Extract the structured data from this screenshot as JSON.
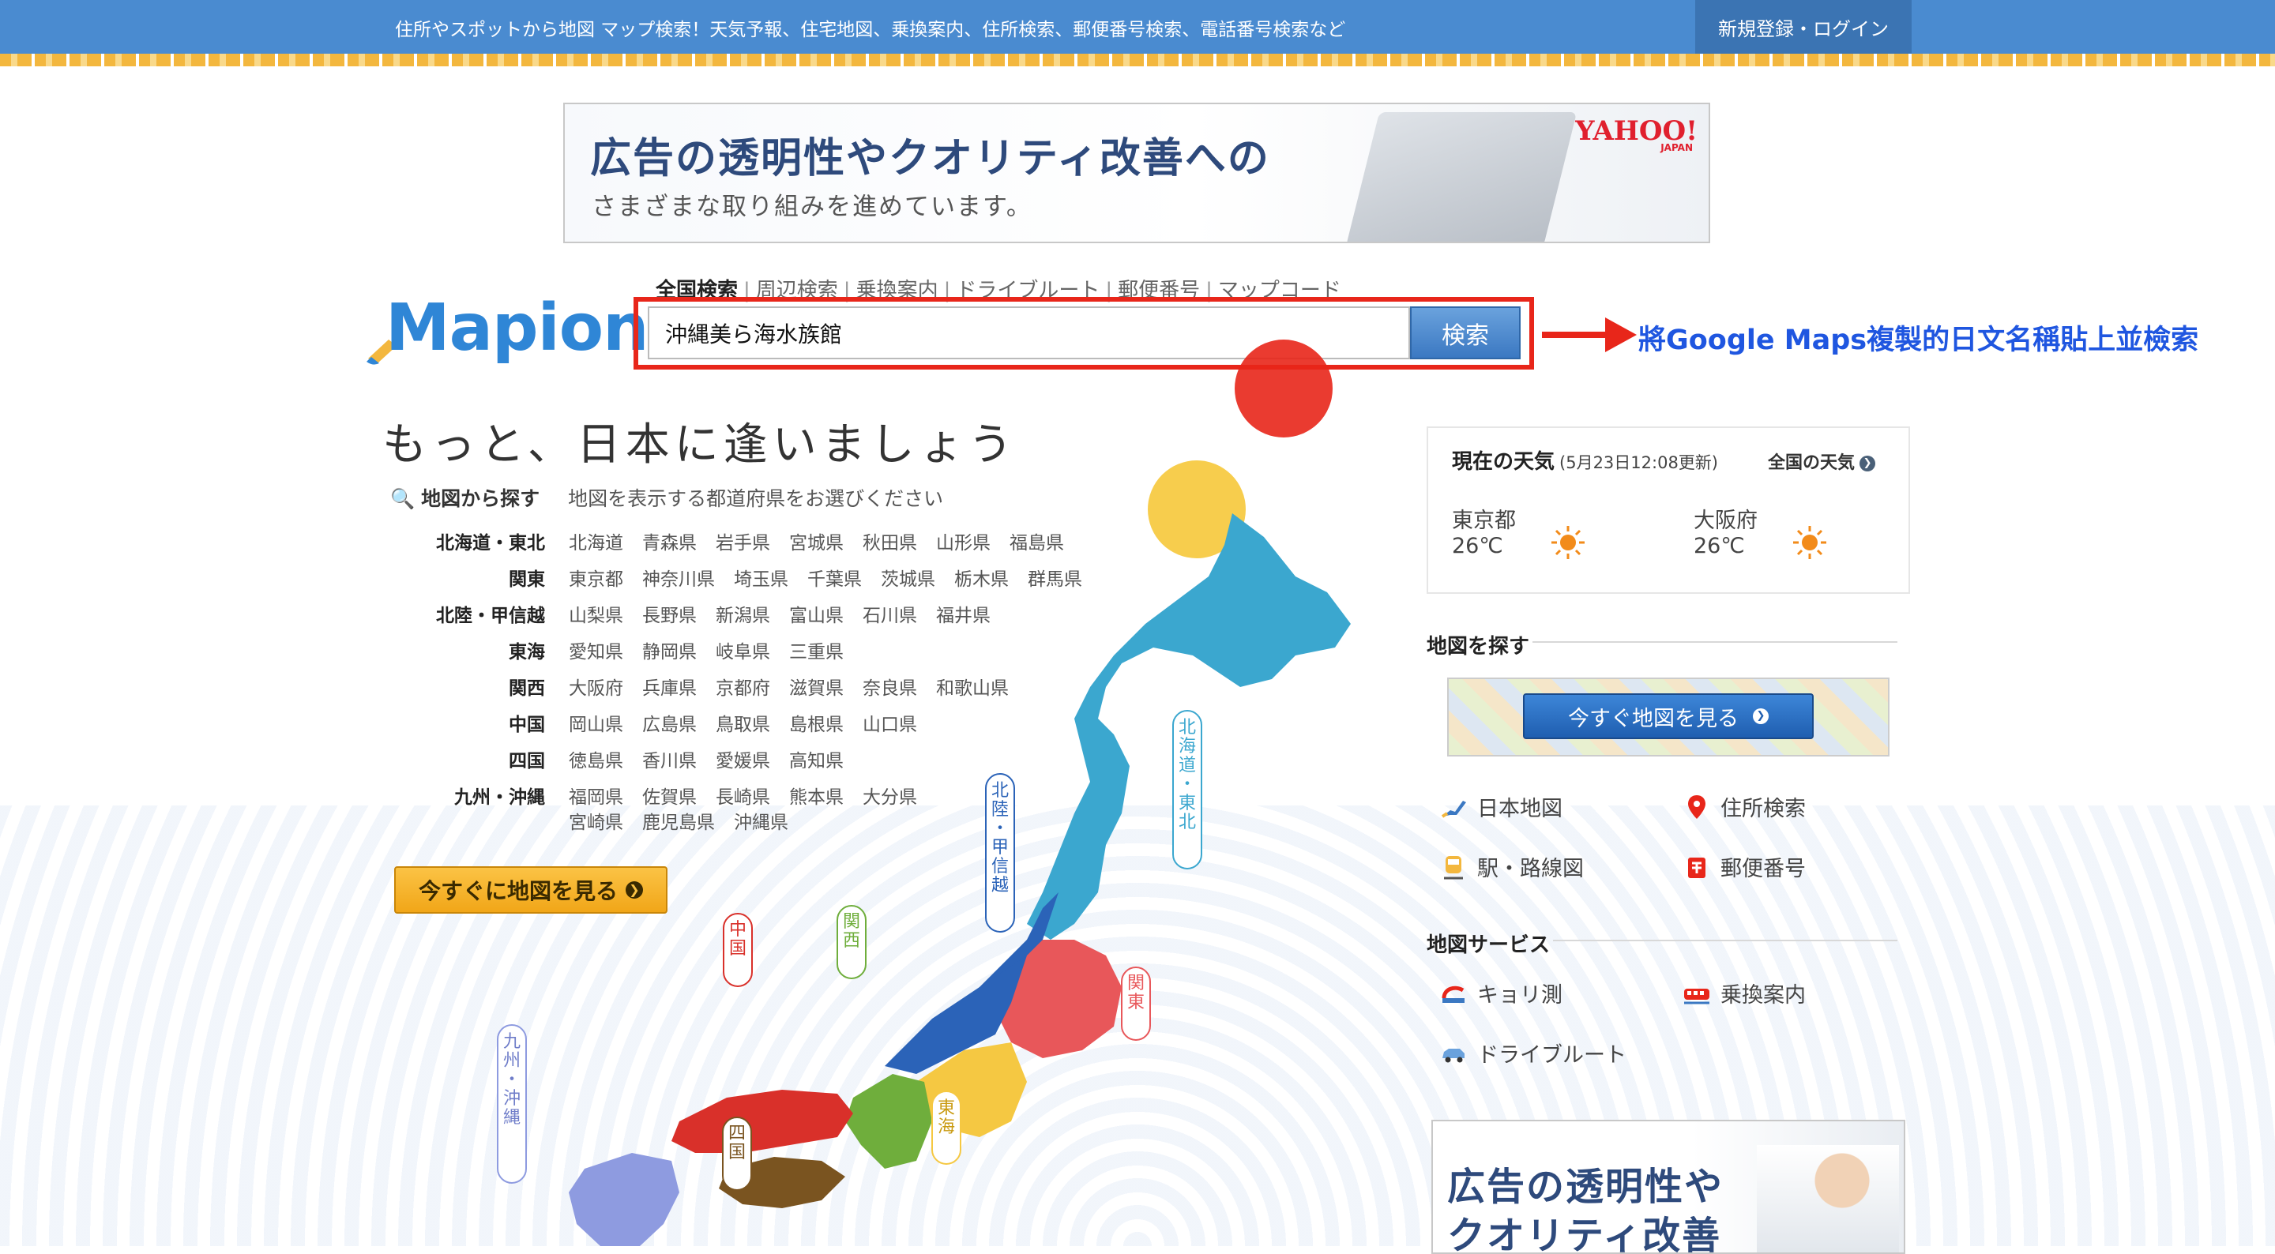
{
  "header": {
    "tagline": "住所やスポットから地図 マップ検索！天気予報、住宅地図、乗換案内、住所検索、郵便番号検索、電話番号検索など",
    "login_label": "新規登録・ログイン",
    "bar_color": "#4a8bd0"
  },
  "ad_top": {
    "title": "広告の透明性やクオリティ改善への",
    "subtitle": "さまざまな取り組みを進めています。",
    "logo": "YAHOO!",
    "logo_sub": "JAPAN"
  },
  "brand": {
    "logo": "Mapion",
    "color": "#2f86d6"
  },
  "search": {
    "tabs": [
      "全国検索",
      "周辺検索",
      "乗換案内",
      "ドライブルート",
      "郵便番号",
      "マップコード"
    ],
    "active_tab": "全国検索",
    "value": "沖縄美ら海水族館",
    "button_label": "検索",
    "highlight_color": "#e8261a"
  },
  "annotation": {
    "text": "將Google Maps複製的日文名稱貼上並檢索",
    "color": "#1f56e0"
  },
  "main": {
    "headline": "もっと、日本に逢いましょう",
    "find_label": "地図から探す",
    "find_hint": "地図を表示する都道府県をお選びください",
    "regions": [
      {
        "name": "北海道・東北",
        "prefs": [
          "北海道",
          "青森県",
          "岩手県",
          "宮城県",
          "秋田県",
          "山形県",
          "福島県"
        ]
      },
      {
        "name": "関東",
        "prefs": [
          "東京都",
          "神奈川県",
          "埼玉県",
          "千葉県",
          "茨城県",
          "栃木県",
          "群馬県"
        ]
      },
      {
        "name": "北陸・甲信越",
        "prefs": [
          "山梨県",
          "長野県",
          "新潟県",
          "富山県",
          "石川県",
          "福井県"
        ]
      },
      {
        "name": "東海",
        "prefs": [
          "愛知県",
          "静岡県",
          "岐阜県",
          "三重県"
        ]
      },
      {
        "name": "関西",
        "prefs": [
          "大阪府",
          "兵庫県",
          "京都府",
          "滋賀県",
          "奈良県",
          "和歌山県"
        ]
      },
      {
        "name": "中国",
        "prefs": [
          "岡山県",
          "広島県",
          "鳥取県",
          "島根県",
          "山口県"
        ]
      },
      {
        "name": "四国",
        "prefs": [
          "徳島県",
          "香川県",
          "愛媛県",
          "高知県"
        ]
      },
      {
        "name": "九州・沖縄",
        "prefs": [
          "福岡県",
          "佐賀県",
          "長崎県",
          "熊本県",
          "大分県"
        ],
        "prefs2": [
          "宮崎県",
          "鹿児島県",
          "沖縄県"
        ]
      }
    ],
    "cta_label": "今すぐに地図を見る",
    "map_labels": {
      "hokkaido": "北海道・東北",
      "hokuriku": "北陸・甲信越",
      "kanto": "関東",
      "chugoku": "中国",
      "kansai": "関西",
      "tokai": "東海",
      "shikoku": "四国",
      "kyushu": "九州・沖縄"
    },
    "region_colors": {
      "hokkaido": "#3ba7cf",
      "kanto": "#e8575a",
      "hokuriku": "#2b63b8",
      "tokai": "#f5c842",
      "kansai": "#6fae3c",
      "chugoku": "#d9302a",
      "shikoku": "#7a5420",
      "kyushu": "#8e9be0"
    }
  },
  "weather": {
    "title": "現在の天気",
    "updated": "(5月23日12:08更新)",
    "link": "全国の天気",
    "cities": [
      {
        "name": "東京都",
        "temp": "26℃",
        "icon": "sun-icon"
      },
      {
        "name": "大阪府",
        "temp": "26℃",
        "icon": "sun-icon"
      }
    ]
  },
  "find_map": {
    "title": "地図を探す",
    "button_label": "今すぐ地図を見る",
    "links": [
      {
        "label": "日本地図",
        "icon": "japan-map-icon"
      },
      {
        "label": "住所検索",
        "icon": "location-pin-icon"
      },
      {
        "label": "駅・路線図",
        "icon": "train-icon"
      },
      {
        "label": "郵便番号",
        "icon": "postbox-icon"
      }
    ]
  },
  "services": {
    "title": "地図サービス",
    "links": [
      {
        "label": "キョリ測",
        "icon": "ruler-icon"
      },
      {
        "label": "乗換案内",
        "icon": "train-transfer-icon"
      },
      {
        "label": "ドライブルート",
        "icon": "car-icon"
      }
    ]
  },
  "ad_bottom": {
    "title_line1": "広告の透明性や",
    "title_line2": "クオリティ改善"
  }
}
